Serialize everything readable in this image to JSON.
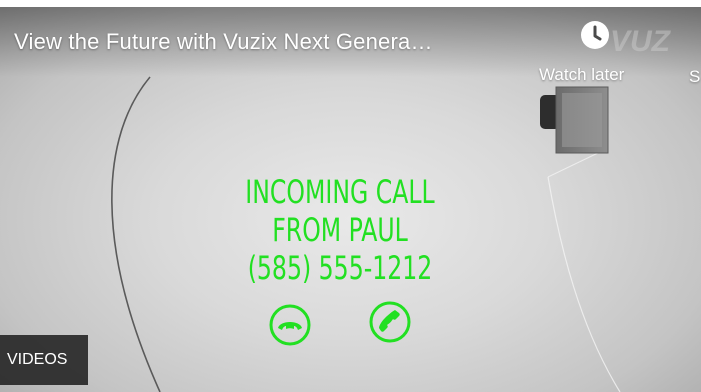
{
  "video": {
    "title": "View the Future with Vuzix Next Genera…"
  },
  "overlay": {
    "watch_later_label": "Watch later",
    "watch_later_icon": "clock-icon",
    "share_partial_label": "S",
    "more_videos_label": "VIDEOS"
  },
  "incoming_call": {
    "line1": "INCOMING CALL",
    "line2": "FROM PAUL",
    "line3": "(585) 555-1212",
    "decline_icon": "phone-hangup-icon",
    "accept_icon": "phone-answer-icon",
    "color": "#22e022"
  }
}
